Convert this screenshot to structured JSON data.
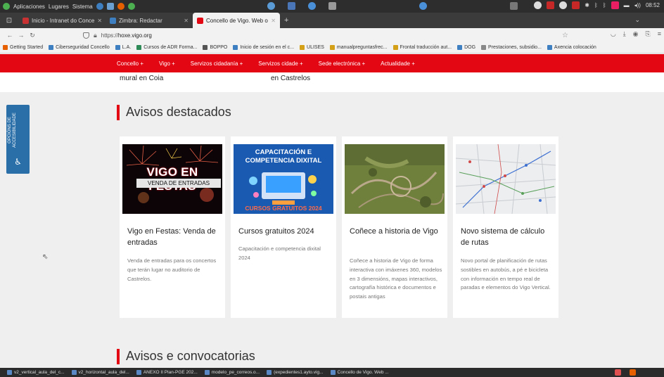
{
  "os": {
    "menu": [
      "Aplicaciones",
      "Lugares",
      "Sistema"
    ],
    "clock": "08:52"
  },
  "tabs": [
    {
      "label": "Inicio - Intranet do Conce",
      "color": "#c83232",
      "active": false
    },
    {
      "label": "Zimbra: Redactar",
      "color": "#3d7fc1",
      "active": false
    },
    {
      "label": "Concello de Vigo. Web o",
      "color": "#e30613",
      "active": true
    }
  ],
  "address": {
    "scheme": "https://",
    "host": "hoxe.vigo.org"
  },
  "bookmarks": [
    {
      "label": "Getting Started",
      "color": "#e66000"
    },
    {
      "label": "Ciberseguridad Concello",
      "color": "#3d7fc1"
    },
    {
      "label": "L.A.",
      "color": "#3d7fc1"
    },
    {
      "label": "Cursos de ADR Forma...",
      "color": "#2e8b57"
    },
    {
      "label": "BOPPO",
      "color": "#555555"
    },
    {
      "label": "Inicio de sesión en el c...",
      "color": "#3d7fc1"
    },
    {
      "label": "ULISES",
      "color": "#d4a017"
    },
    {
      "label": "manualpreguntasfrec...",
      "color": "#d4a017"
    },
    {
      "label": "Frontal traducción aut...",
      "color": "#d4a017"
    },
    {
      "label": "DOG",
      "color": "#3d7fc1"
    },
    {
      "label": "Prestaciones, subsidio...",
      "color": "#888888"
    },
    {
      "label": "Axencia colocación",
      "color": "#3d7fc1"
    }
  ],
  "site_menu": [
    "Concello +",
    "Vigo +",
    "Servizos cidadanía +",
    "Servizos cidade +",
    "Sede electrónica +",
    "Actualidade +"
  ],
  "strip_left": "mural en Coia",
  "strip_right": "en Castrelos",
  "section1": "Avisos destacados",
  "section2": "Avisos e convocatorias",
  "accessibility": {
    "label": "OPCIÓNS DE ACCESIBILIDADE"
  },
  "cards": [
    {
      "title": "Vigo en Festas: Venda de entradas",
      "desc": "Venda de entradas para os concertos que terán lugar no auditorio de Castrelos.",
      "img_title": "VIGO EN FESTAS",
      "img_sub": "VENDA DE ENTRADAS"
    },
    {
      "title": "Cursos gratuitos 2024",
      "desc": "Capacitación e competencia dixital 2024",
      "img_title": "CAPACITACIÓN E COMPETENCIA DIXITAL",
      "img_sub": "CURSOS GRATUITOS 2024"
    },
    {
      "title": "Coñece a historia de Vigo",
      "desc": "Coñece a historia de Vigo de forma interactiva con imáxenes 360, modelos en 3 dimensións, mapas interactivos, cartografía histórica e documentos e postais antigas",
      "img_title": "",
      "img_sub": ""
    },
    {
      "title": "Novo sistema de cálculo de rutas",
      "desc": "Novo portal de planificación de rutas sostibles en autobús, a pé e bicicleta con información en tempo real de paradas e elementos do Vigo Vertical.",
      "img_title": "",
      "img_sub": ""
    }
  ],
  "taskbar": [
    "v2_vertical_aula_del_c...",
    "v2_horizontal_aula_del...",
    "ANEXO II Plan-PGE 202...",
    "modelo_pe_correos.o...",
    "(expedientes1.ayto.vig...",
    "Concello de Vigo. Web ..."
  ]
}
